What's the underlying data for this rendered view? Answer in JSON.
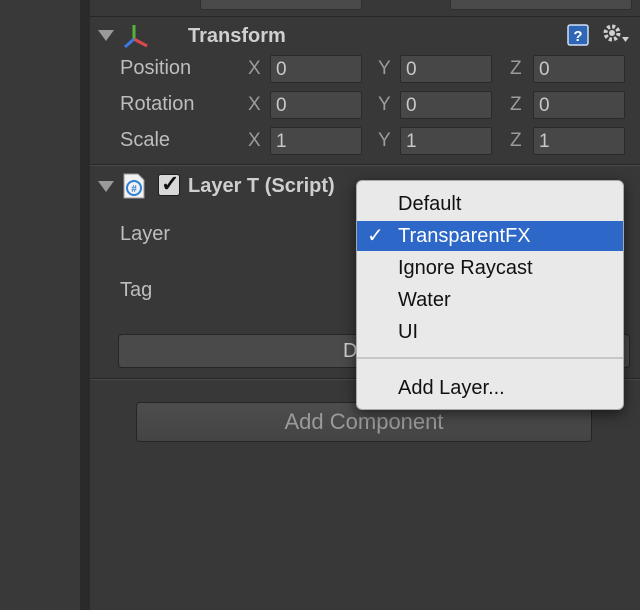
{
  "transform": {
    "title": "Transform",
    "position_label": "Position",
    "rotation_label": "Rotation",
    "scale_label": "Scale",
    "axis_x": "X",
    "axis_y": "Y",
    "axis_z": "Z",
    "position": {
      "x": "0",
      "y": "0",
      "z": "0"
    },
    "rotation": {
      "x": "0",
      "y": "0",
      "z": "0"
    },
    "scale": {
      "x": "1",
      "y": "1",
      "z": "1"
    }
  },
  "script_component": {
    "title": "Layer T (Script)",
    "enabled_check": "✓",
    "layer_label": "Layer",
    "tag_label": "Tag",
    "partial_button_text": "D"
  },
  "add_component_label": "Add Component",
  "layer_menu": {
    "items": [
      "Default",
      "TransparentFX",
      "Ignore Raycast",
      "Water",
      "UI"
    ],
    "selected_index": 1,
    "check_glyph": "✓",
    "add_layer": "Add Layer..."
  },
  "colors": {
    "selection": "#2d67c8",
    "panel": "#383838"
  }
}
